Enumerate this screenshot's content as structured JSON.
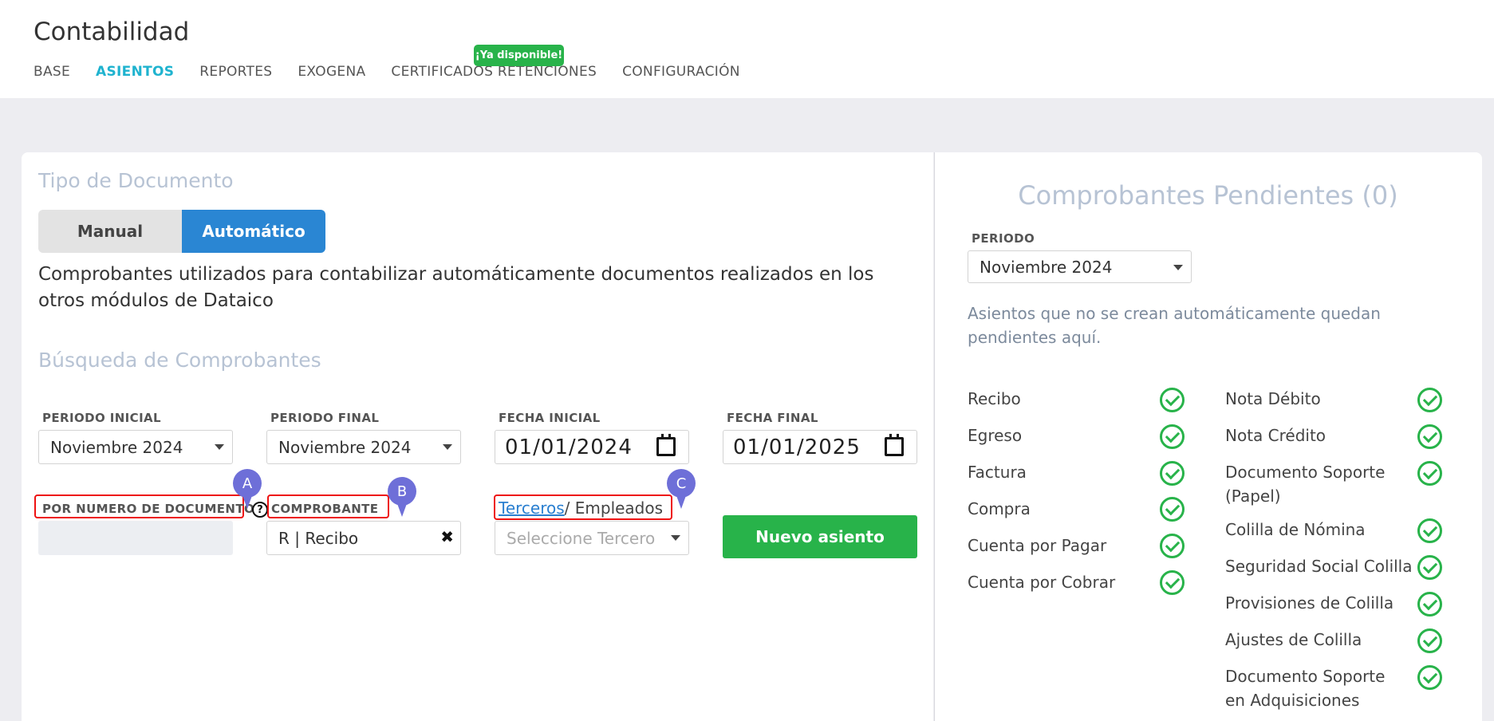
{
  "header": {
    "title": "Contabilidad",
    "nav": [
      "BASE",
      "ASIENTOS",
      "REPORTES",
      "EXOGENA",
      "CERTIFICADOS RETENCIONES",
      "CONFIGURACIÓN"
    ],
    "active_tab": "ASIENTOS",
    "new_badge": "¡Ya disponible!"
  },
  "tipo_documento": {
    "title": "Tipo de Documento",
    "manual_label": "Manual",
    "auto_label": "Automático",
    "selected": "Automático",
    "description": "Comprobantes utilizados para contabilizar automáticamente documentos realizados en los otros módulos de Dataico"
  },
  "busqueda": {
    "title": "Búsqueda de Comprobantes",
    "periodo_inicial": {
      "label": "PERIODO INICIAL",
      "value": "Noviembre 2024"
    },
    "periodo_final": {
      "label": "PERIODO FINAL",
      "value": "Noviembre 2024"
    },
    "fecha_inicial": {
      "label": "FECHA INICIAL",
      "value": "01/01/2024"
    },
    "fecha_final": {
      "label": "FECHA FINAL",
      "value": "01/01/2025"
    },
    "por_numero": {
      "label": "POR NUMERO DE DOCUMENTO",
      "help": "?"
    },
    "comprobante": {
      "label": "COMPROBANTE",
      "value": "R | Recibo",
      "clear": "✖"
    },
    "terceros": {
      "link": "Terceros",
      "rest": "/ Empleados",
      "placeholder": "Seleccione Tercero"
    },
    "nuevo_asiento": "Nuevo asiento",
    "markers": [
      "A",
      "B",
      "C"
    ]
  },
  "pendientes": {
    "title": "Comprobantes Pendientes (0)",
    "periodo": {
      "label": "PERIODO",
      "value": "Noviembre 2024"
    },
    "description": "Asientos que no se crean automáticamente quedan pendientes aquí.",
    "left_items": [
      "Recibo",
      "Egreso",
      "Factura",
      "Compra",
      "Cuenta por Pagar",
      "Cuenta por Cobrar"
    ],
    "right_items": [
      "Nota Débito",
      "Nota Crédito",
      "Documento Soporte (Papel)",
      "Colilla de Nómina",
      "Seguridad Social Colilla",
      "Provisiones de Colilla",
      "Ajustes de Colilla",
      "Documento Soporte en Adquisiciones"
    ]
  },
  "colors": {
    "accent": "#1fb3cf",
    "primary": "#2a86d3",
    "success": "#28b34a",
    "highlight": "#e11111",
    "marker": "#6e6fd8"
  }
}
